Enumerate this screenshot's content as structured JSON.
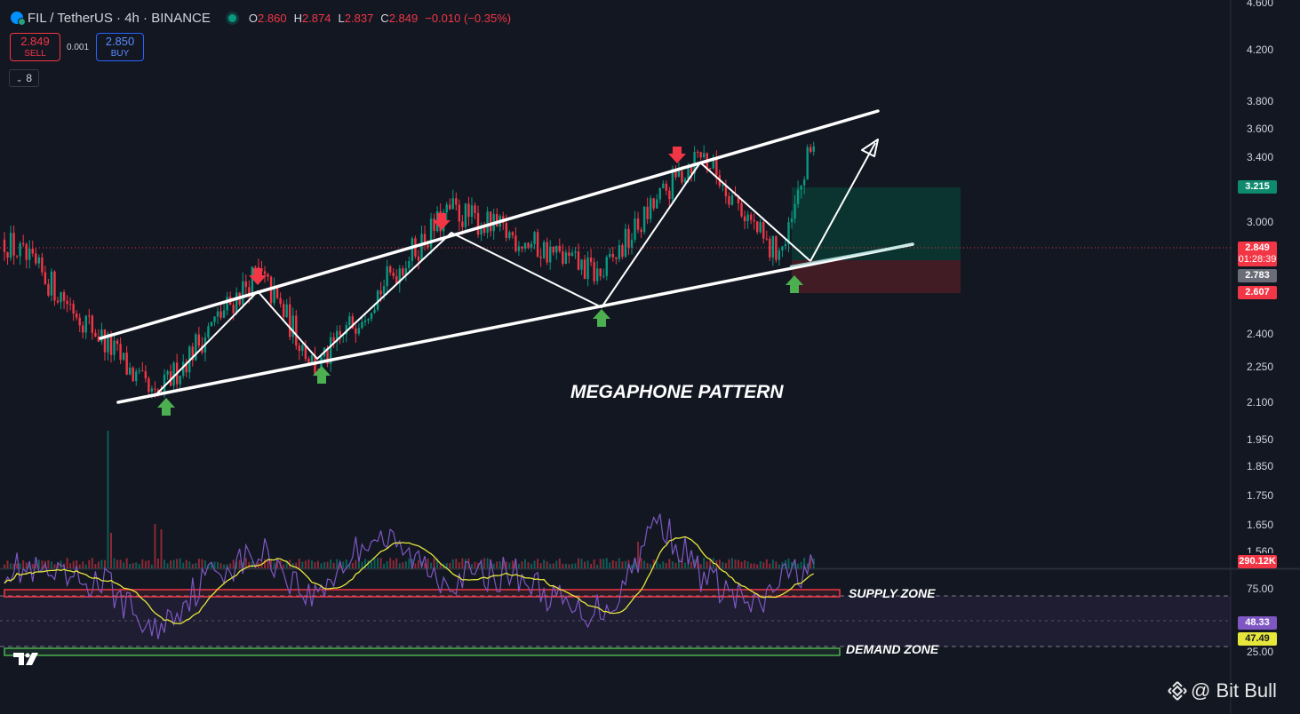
{
  "header": {
    "symbol": "FIL / TetherUS · 4h · BINANCE",
    "ohlc": [
      {
        "k": "O",
        "v": "2.860"
      },
      {
        "k": "H",
        "v": "2.874"
      },
      {
        "k": "L",
        "v": "2.837"
      },
      {
        "k": "C",
        "v": "2.849"
      },
      {
        "k": "",
        "v": "−0.010 (−0.35%)"
      }
    ]
  },
  "trade": {
    "sell_price": "2.849",
    "sell_label": "SELL",
    "buy_price": "2.850",
    "buy_label": "BUY",
    "spread": "0.001"
  },
  "indicators_toggle": {
    "count": "8"
  },
  "annotations": {
    "pattern": "MEGAPHONE PATTERN",
    "supply": "SUPPLY ZONE",
    "demand": "DEMAND ZONE"
  },
  "watermark": "@ Bit Bull",
  "price_axis": {
    "ticks": [
      "4.200",
      "3.800",
      "3.600",
      "3.400",
      "3.200",
      "3.000",
      "2.400",
      "2.250",
      "2.100",
      "1.950",
      "1.850",
      "1.750",
      "1.650",
      "1.560"
    ],
    "top_cut": "4.600",
    "labels": {
      "target": "3.215",
      "last_price": "2.849",
      "countdown": "01:28:39",
      "entry": "2.783",
      "stop": "2.607",
      "volume": "290.12K"
    }
  },
  "rsi_axis": {
    "ticks": [
      "75.00",
      "25.00"
    ],
    "rsi": "48.33",
    "rsi_ma": "47.49"
  },
  "colors": {
    "bg": "#131722",
    "up": "#089981",
    "down": "#f23645",
    "rsi": "#7e57c2",
    "rsi_ma": "#e6e63b",
    "supply": "#f23645",
    "demand": "#4caf50",
    "long_profit": "#0b3a33",
    "long_loss": "#4a1d24"
  },
  "chart_data": {
    "type": "candlestick",
    "title": "FIL / TetherUS · 4h · BINANCE",
    "ylim": [
      1.56,
      4.6
    ],
    "y_scale": "log",
    "last": {
      "open": 2.86,
      "high": 2.874,
      "low": 2.837,
      "close": 2.849,
      "change": -0.01,
      "change_pct": -0.35
    },
    "swing_path": [
      2.88,
      2.1,
      2.7,
      2.23,
      3.05,
      2.68,
      3.42,
      2.82,
      2.85,
      3.55
    ],
    "long_position": {
      "target": 3.215,
      "entry": 2.783,
      "stop": 2.607
    },
    "volume_last": "290.12K",
    "rsi": {
      "value": 48.33,
      "ma": 47.49,
      "bands": [
        75,
        25
      ]
    }
  }
}
